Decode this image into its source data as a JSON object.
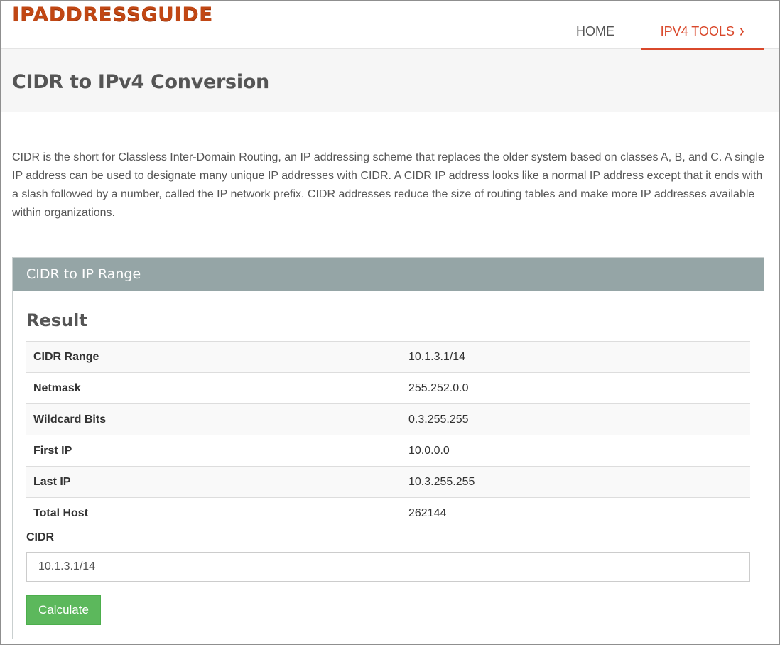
{
  "header": {
    "logo_text": "IPADDRESSGUIDE",
    "nav": {
      "home": "HOME",
      "tools": "IPV4 TOOLS"
    }
  },
  "page": {
    "title": "CIDR to IPv4 Conversion",
    "intro": "CIDR is the short for Classless Inter-Domain Routing, an IP addressing scheme that replaces the older system based on classes A, B, and C. A single IP address can be used to designate many unique IP addresses with CIDR. A CIDR IP address looks like a normal IP address except that it ends with a slash followed by a number, called the IP network prefix. CIDR addresses reduce the size of routing tables and make more IP addresses available within organizations."
  },
  "panel": {
    "title": "CIDR to IP Range",
    "result_title": "Result",
    "rows": [
      {
        "label": "CIDR Range",
        "value": "10.1.3.1/14"
      },
      {
        "label": "Netmask",
        "value": "255.252.0.0"
      },
      {
        "label": "Wildcard Bits",
        "value": "0.3.255.255"
      },
      {
        "label": "First IP",
        "value": "10.0.0.0"
      },
      {
        "label": "Last IP",
        "value": "10.3.255.255"
      },
      {
        "label": "Total Host",
        "value": "262144"
      }
    ],
    "cidr_label": "CIDR",
    "cidr_value": "10.1.3.1/14",
    "button": "Calculate"
  },
  "colors": {
    "brand": "#c14714",
    "nav_active": "#d9482b",
    "panel_header": "#95a5a6",
    "button": "#5cb85c"
  },
  "icons": {
    "nav_dropdown": "chevron-down-icon"
  }
}
